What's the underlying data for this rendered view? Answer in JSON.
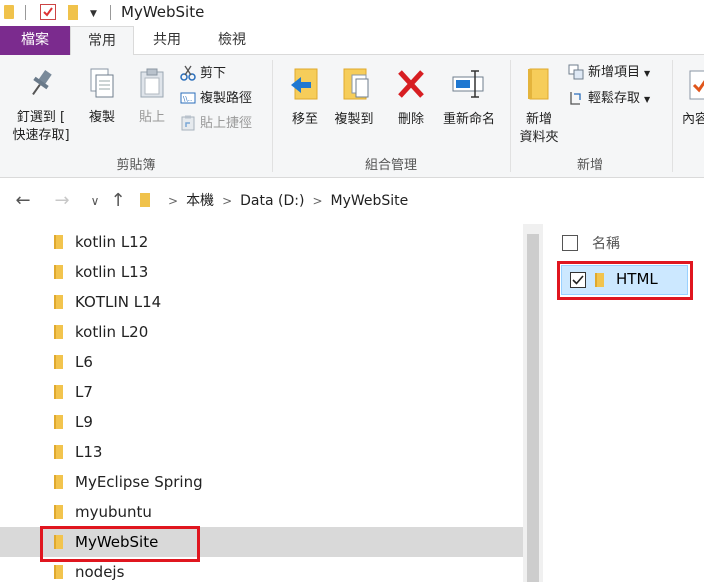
{
  "window": {
    "title": "MyWebSite"
  },
  "ribbon_tabs": {
    "file": "檔案",
    "home": "常用",
    "share": "共用",
    "view": "檢視"
  },
  "ribbon": {
    "clipboard": {
      "label": "剪貼簿",
      "pin_line1": "釘選到 [",
      "pin_line2": "快速存取]",
      "copy": "複製",
      "paste": "貼上",
      "cut": "剪下",
      "copy_path": "複製路徑",
      "paste_shortcut": "貼上捷徑"
    },
    "organize": {
      "label": "組合管理",
      "move_to": "移至",
      "copy_to": "複製到",
      "delete": "刪除",
      "rename": "重新命名"
    },
    "new": {
      "label": "新增",
      "new_folder_line1": "新增",
      "new_folder_line2": "資料夾",
      "new_item": "新增項目",
      "easy_access": "輕鬆存取"
    },
    "open": {
      "properties": "內容"
    }
  },
  "address_bar": {
    "crumbs": [
      "本機",
      "Data (D:)",
      "MyWebSite"
    ]
  },
  "tree": {
    "items": [
      {
        "label": "kotlin L12"
      },
      {
        "label": "kotlin L13"
      },
      {
        "label": "KOTLIN L14"
      },
      {
        "label": "kotlin L20"
      },
      {
        "label": "L6"
      },
      {
        "label": "L7"
      },
      {
        "label": "L9"
      },
      {
        "label": "L13"
      },
      {
        "label": "MyEclipse Spring"
      },
      {
        "label": "myubuntu"
      },
      {
        "label": "MyWebSite"
      },
      {
        "label": "nodejs"
      }
    ],
    "selected": "MyWebSite"
  },
  "content": {
    "header_name": "名稱",
    "files": [
      {
        "label": "HTML",
        "checked": true
      }
    ]
  },
  "colors": {
    "file_tab": "#7b2b8e",
    "highlight_box": "#e0161f",
    "folder": "#f2c44e",
    "selection": "#cce8ff"
  }
}
